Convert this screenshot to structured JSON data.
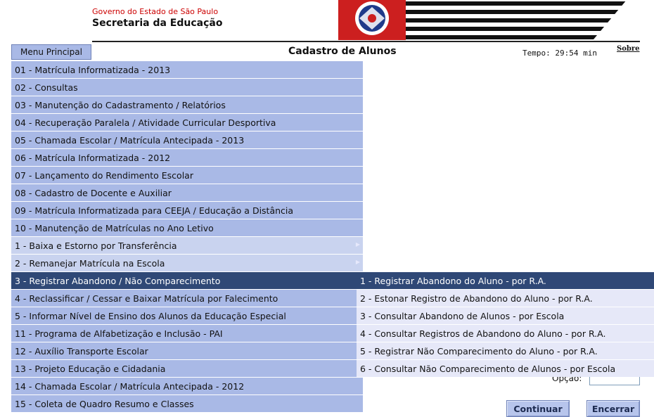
{
  "header": {
    "government": "Governo do Estado de São Paulo",
    "secretariat": "Secretaria da Educação"
  },
  "toolbar": {
    "menu_principal": "Menu Principal",
    "title": "Cadastro de Alunos",
    "timer": "Tempo: 29:54 min",
    "about": "Sobre"
  },
  "menu": {
    "items": [
      {
        "label": "01 - Matrícula Informatizada - 2013"
      },
      {
        "label": "02 - Consultas"
      },
      {
        "label": "03 - Manutenção do Cadastramento / Relatórios"
      },
      {
        "label": "04 - Recuperação Paralela / Atividade Curricular Desportiva"
      },
      {
        "label": "05 - Chamada Escolar / Matrícula Antecipada - 2013"
      },
      {
        "label": "06 - Matrícula Informatizada - 2012"
      },
      {
        "label": "07 - Lançamento do Rendimento Escolar"
      },
      {
        "label": "08 - Cadastro de Docente e Auxiliar"
      },
      {
        "label": "09 - Matrícula Informatizada para CEEJA / Educação a Distância"
      },
      {
        "label": "10 - Manutenção de Matrículas no Ano Letivo"
      },
      {
        "label": "1 - Baixa e Estorno por Transferência"
      },
      {
        "label": "2 - Remanejar Matrícula na Escola"
      },
      {
        "label": "3 - Registrar Abandono / Não Comparecimento"
      },
      {
        "label": "4 - Reclassificar / Cessar e Baixar Matrícula por Falecimento"
      },
      {
        "label": "5 - Informar Nível de Ensino dos Alunos da Educação Especial"
      },
      {
        "label": "11 - Programa de Alfabetização e Inclusão - PAI"
      },
      {
        "label": "12 - Auxílio Transporte Escolar"
      },
      {
        "label": "13 - Projeto Educação e Cidadania"
      },
      {
        "label": "14 - Chamada Escolar / Matrícula Antecipada - 2012"
      },
      {
        "label": "15 - Coleta de Quadro Resumo e Classes"
      }
    ]
  },
  "submenu": {
    "items": [
      {
        "label": "1 - Registrar Abandono do Aluno - por R.A."
      },
      {
        "label": "2 - Estonar Registro de Abandono do Aluno - por R.A."
      },
      {
        "label": "3 - Consultar Abandono de Alunos - por Escola"
      },
      {
        "label": "4 - Consultar Registros de Abandono do Aluno - por R.A."
      },
      {
        "label": "5 - Registrar Não Comparecimento do Aluno - por R.A."
      },
      {
        "label": "6 - Consultar Não Comparecimento de Alunos - por Escola"
      }
    ]
  },
  "form": {
    "option_label": "Opção:",
    "option_value": ""
  },
  "buttons": {
    "continue": "Continuar",
    "close": "Encerrar"
  },
  "colors": {
    "menu_bg": "#a9b9e6",
    "menu_bg_alt": "#c9d3ef",
    "selected_bg": "#2f4876",
    "submenu_bg": "#e6e8f8",
    "government_text": "#cc0000"
  },
  "icons": {
    "flag": "sao-paulo-state-flag-icon",
    "submenu_arrow": "submenu-arrow-icon"
  }
}
